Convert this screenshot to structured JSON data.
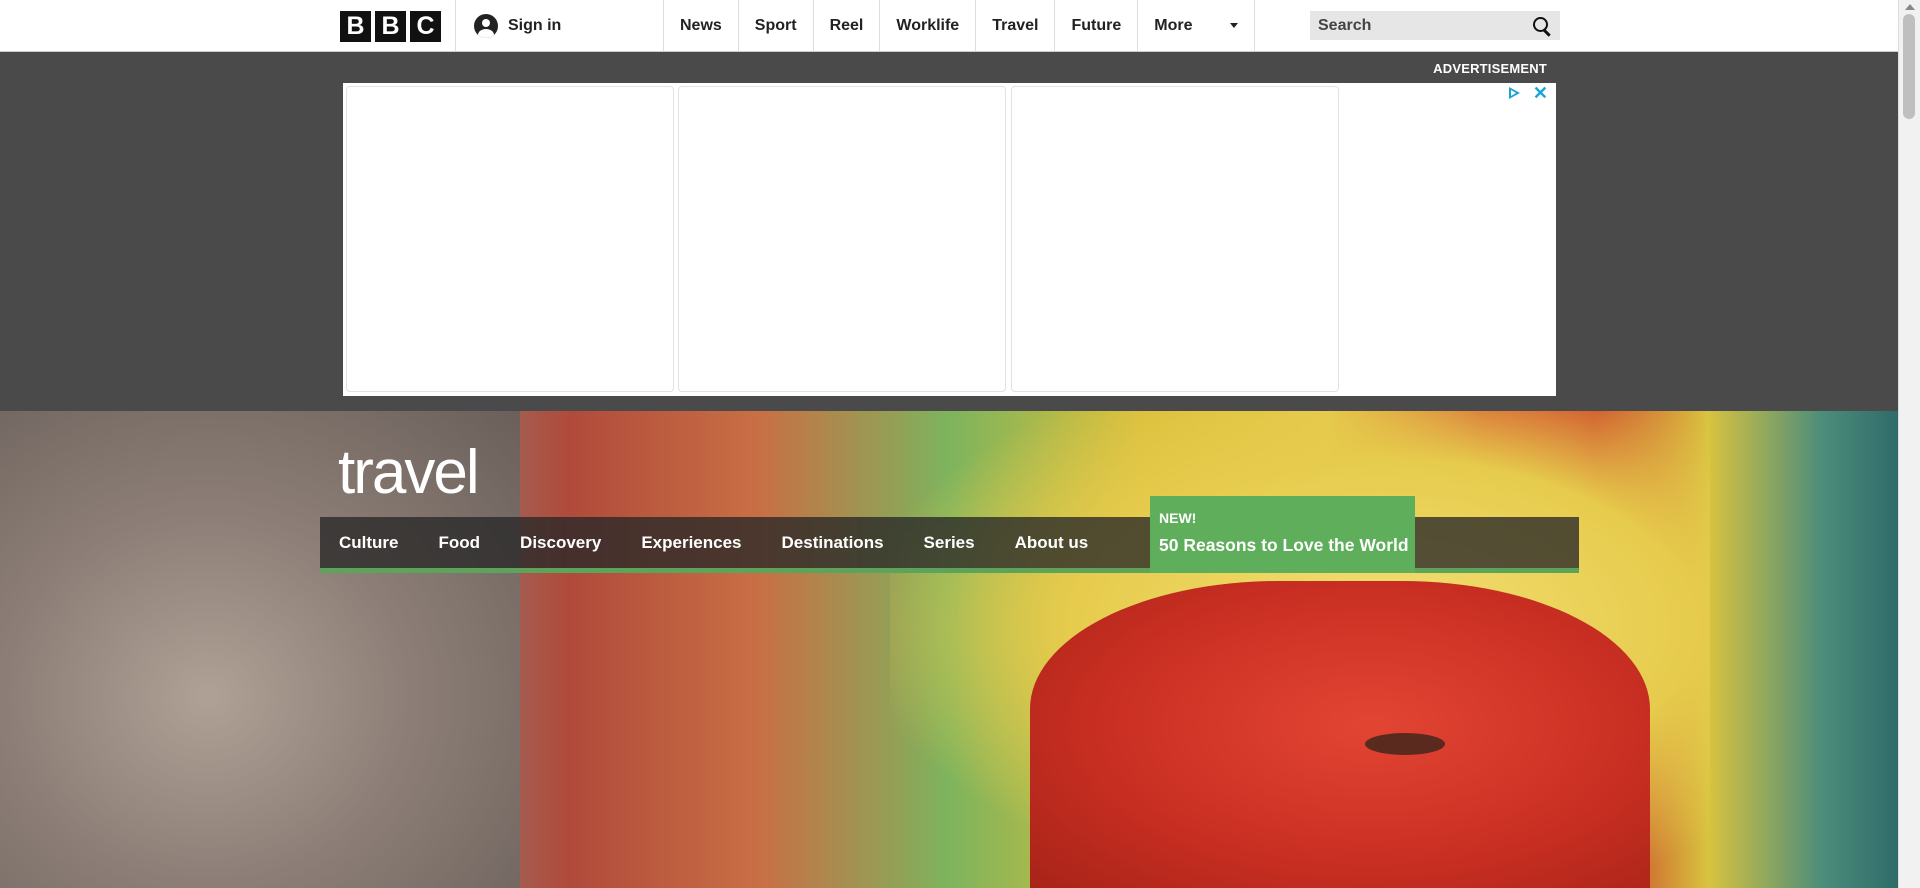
{
  "topbar": {
    "logo_letters": [
      "B",
      "B",
      "C"
    ],
    "sign_in_label": "Sign in",
    "nav": [
      "News",
      "Sport",
      "Reel",
      "Worklife",
      "Travel",
      "Future"
    ],
    "more_label": "More",
    "search_placeholder": "Search"
  },
  "ad": {
    "label": "ADVERTISEMENT",
    "close_glyph": "✕"
  },
  "travel": {
    "logo_text": "travel",
    "nav": [
      "Culture",
      "Food",
      "Discovery",
      "Experiences",
      "Destinations",
      "Series",
      "About us"
    ],
    "promo": {
      "badge": "NEW!",
      "title": "50 Reasons to Love the World"
    }
  },
  "colors": {
    "accent_green": "#5fae5b",
    "ad_choice_blue": "#19a5d2",
    "dark_band": "#4a4a4a"
  }
}
